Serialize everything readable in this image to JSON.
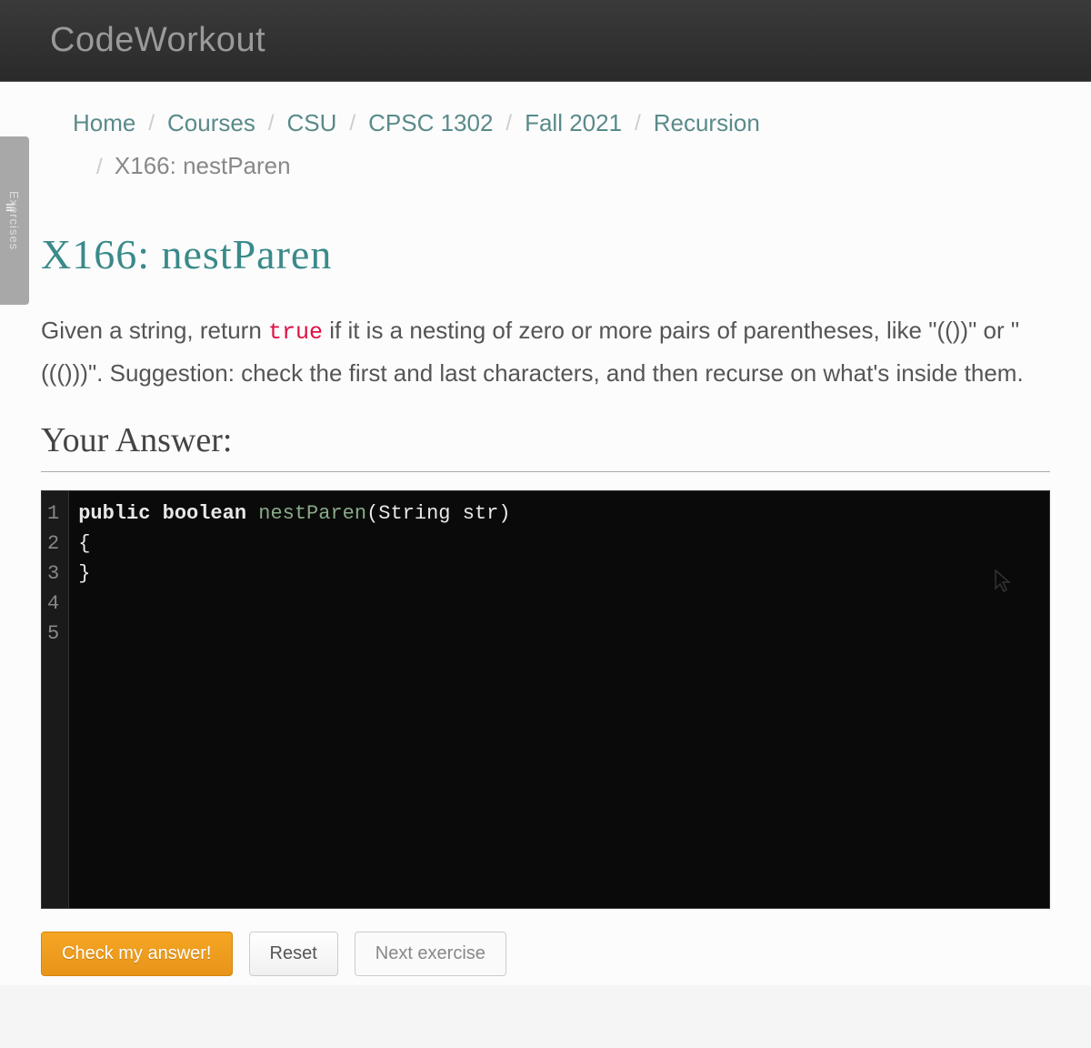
{
  "header": {
    "logo_code": "Code",
    "logo_workout": "Workout"
  },
  "breadcrumb": {
    "items": [
      "Home",
      "Courses",
      "CSU",
      "CPSC 1302",
      "Fall 2021",
      "Recursion"
    ],
    "current": "X166: nestParen",
    "separator": "/"
  },
  "sidebar": {
    "label": "Exercises"
  },
  "page": {
    "title": "X166: nestParen"
  },
  "problem": {
    "text_before": "Given a string, return ",
    "code_true": "true",
    "text_after": " if it is a nesting of zero or more pairs of parentheses, like \"(())\" or \"((()))\". Suggestion: check the first and last characters, and then recurse on what's inside them."
  },
  "answer": {
    "label": "Your Answer:"
  },
  "editor": {
    "line_numbers": [
      "1",
      "2",
      "3",
      "4",
      "5"
    ],
    "code": {
      "line1": {
        "public": "public",
        "boolean": "boolean",
        "fn": "nestParen",
        "param_type": "String",
        "param_name": "str"
      },
      "line2": "{",
      "line3": "",
      "line4": "}",
      "line5": ""
    }
  },
  "buttons": {
    "check": "Check my answer!",
    "reset": "Reset",
    "next": "Next exercise"
  }
}
